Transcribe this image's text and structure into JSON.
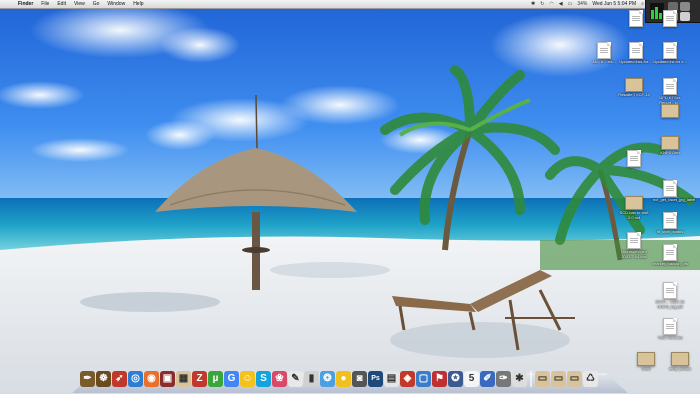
{
  "menubar": {
    "app_menu": "Finder",
    "items": [
      "File",
      "Edit",
      "View",
      "Go",
      "Window",
      "Help"
    ],
    "battery": "34%",
    "clock": "Wed Jun 5  5:04 PM"
  },
  "desktop_icons": [
    {
      "label": "",
      "kind": "doc"
    },
    {
      "label": "",
      "kind": "doc"
    },
    {
      "label": "Ja... 6... xls...",
      "kind": "doc"
    },
    {
      "label": "Updated lists for ...",
      "kind": "doc"
    },
    {
      "label": "Updated list for x...",
      "kind": "doc"
    },
    {
      "label": "Rosallie TXCF-14",
      "kind": "folder"
    },
    {
      "label": "UPD KTSxx Report - xl...",
      "kind": "doc"
    },
    {
      "label": "",
      "kind": "folder"
    },
    {
      "label": "KNPS Den",
      "kind": "folder"
    },
    {
      "label": "...",
      "kind": "doc"
    },
    {
      "label": "ncf_get_facet_jpg_label",
      "kind": "doc"
    },
    {
      "label": "SCD ban to xlsfl 2.0 ncf",
      "kind": "folder"
    },
    {
      "label": "tit_shell_status",
      "kind": "doc"
    },
    {
      "label": "MicrosoftWord 2003... 64.doc",
      "kind": "doc"
    },
    {
      "label": "marker_backup_cfs",
      "kind": "doc"
    },
    {
      "label": "2044-... 1351 61 01549_log.pdf",
      "kind": "doc"
    },
    {
      "label": "TWC fvml.xfm",
      "kind": "doc"
    },
    {
      "label": "Shelf",
      "kind": "folder"
    },
    {
      "label": "temp photos",
      "kind": "folder"
    }
  ],
  "dock": [
    {
      "name": "finder-pen",
      "glyph": "✒",
      "color": "#7a5a2a"
    },
    {
      "name": "helm",
      "glyph": "☸",
      "color": "#6b4a1e"
    },
    {
      "name": "rocket",
      "glyph": "➶",
      "color": "#c0392b"
    },
    {
      "name": "safari",
      "glyph": "◎",
      "color": "#2e7dd1"
    },
    {
      "name": "firefox",
      "glyph": "◉",
      "color": "#e8702a"
    },
    {
      "name": "photo",
      "glyph": "▣",
      "color": "#8b2d2d"
    },
    {
      "name": "gift",
      "glyph": "▦",
      "color": "#d9c39a"
    },
    {
      "name": "filezilla",
      "glyph": "Z",
      "color": "#c0392b"
    },
    {
      "name": "utorrent",
      "glyph": "µ",
      "color": "#3aa53a"
    },
    {
      "name": "chrome",
      "glyph": "G",
      "color": "#4285f4"
    },
    {
      "name": "smiley",
      "glyph": "☺",
      "color": "#f4c21c"
    },
    {
      "name": "skype",
      "glyph": "S",
      "color": "#13a3dd"
    },
    {
      "name": "lips",
      "glyph": "❀",
      "color": "#d94a6a"
    },
    {
      "name": "note",
      "glyph": "✎",
      "color": "#e8e8e8"
    },
    {
      "name": "usb",
      "glyph": "▮",
      "color": "#d0d0d0"
    },
    {
      "name": "gear",
      "glyph": "❂",
      "color": "#4aa0e0"
    },
    {
      "name": "ball",
      "glyph": "●",
      "color": "#f0c020"
    },
    {
      "name": "camera",
      "glyph": "◙",
      "color": "#555"
    },
    {
      "name": "photoshop",
      "glyph": "Ps",
      "color": "#1d4a7a"
    },
    {
      "name": "script",
      "glyph": "▤",
      "color": "#e6e6e6"
    },
    {
      "name": "redbox",
      "glyph": "◈",
      "color": "#c0392b"
    },
    {
      "name": "windows",
      "glyph": "▢",
      "color": "#3a7dc9"
    },
    {
      "name": "flag",
      "glyph": "⚑",
      "color": "#c03030"
    },
    {
      "name": "compass",
      "glyph": "✪",
      "color": "#3a5a90"
    },
    {
      "name": "calendar",
      "glyph": "5",
      "color": "#f5f5f5"
    },
    {
      "name": "pencil",
      "glyph": "✐",
      "color": "#3a6ac0"
    },
    {
      "name": "pen-tool",
      "glyph": "✑",
      "color": "#777"
    },
    {
      "name": "spider",
      "glyph": "✱",
      "color": "#ddd"
    },
    {
      "name": "folder-a",
      "glyph": "▭",
      "color": "#d9c39a"
    },
    {
      "name": "folder-b",
      "glyph": "▭",
      "color": "#d9c39a"
    },
    {
      "name": "folder-c",
      "glyph": "▭",
      "color": "#d9c39a"
    },
    {
      "name": "trash",
      "glyph": "♺",
      "color": "#e8e8e8"
    }
  ]
}
